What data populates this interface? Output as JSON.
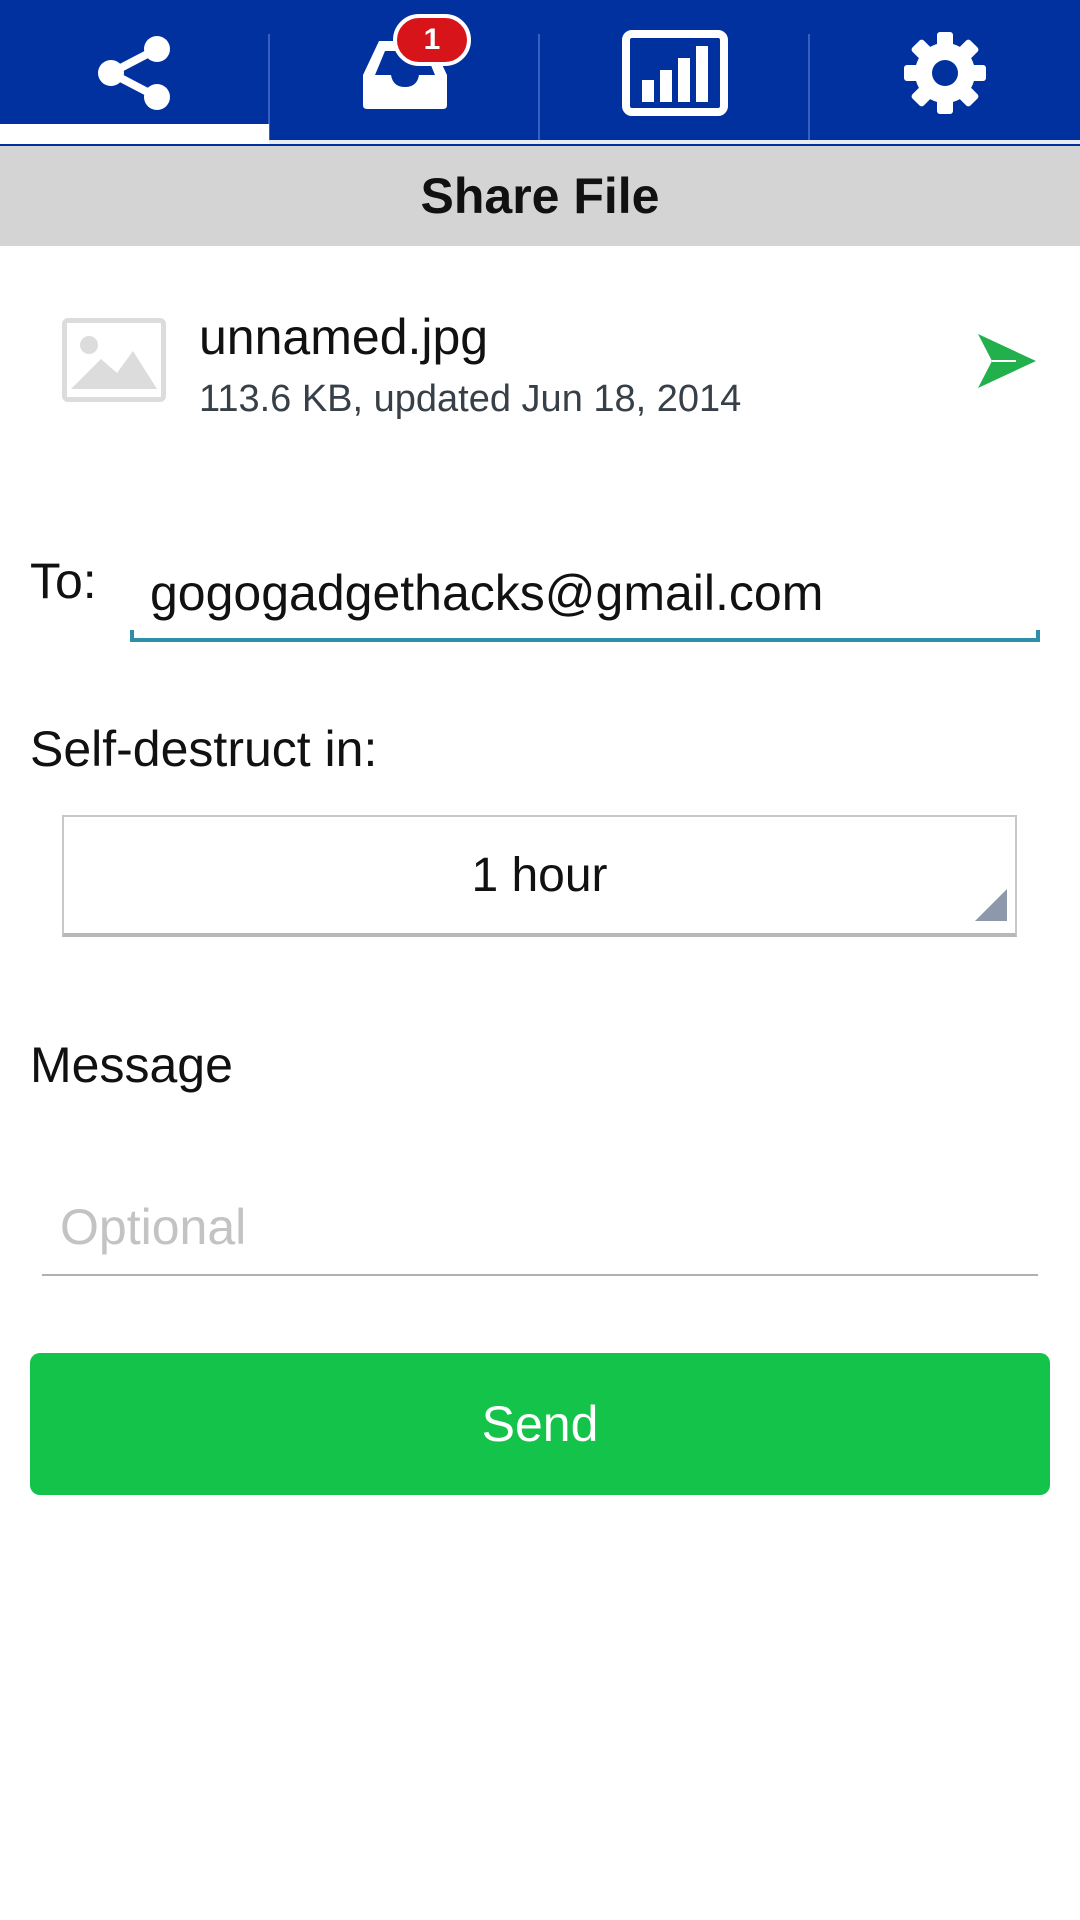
{
  "tabs": [
    {
      "name": "share",
      "icon": "share-icon"
    },
    {
      "name": "inbox",
      "icon": "inbox-icon",
      "badge": "1"
    },
    {
      "name": "stats",
      "icon": "bar-chart-icon"
    },
    {
      "name": "settings",
      "icon": "gear-icon"
    }
  ],
  "header": {
    "title": "Share File"
  },
  "file": {
    "name": "unnamed.jpg",
    "meta": "113.6 KB, updated Jun 18, 2014",
    "thumbnail_icon": "image-placeholder-icon",
    "action_icon": "send-arrow-icon"
  },
  "form": {
    "to_label": "To:",
    "to_value": "gogogadgethacks@gmail.com",
    "self_destruct_label": "Self-destruct in:",
    "self_destruct_value": "1 hour",
    "message_label": "Message",
    "message_placeholder": "Optional",
    "send_label": "Send"
  },
  "colors": {
    "tabbar": "#00319e",
    "badge": "#d7141a",
    "accent_green": "#13c34a",
    "underline": "#2f8ea8"
  }
}
